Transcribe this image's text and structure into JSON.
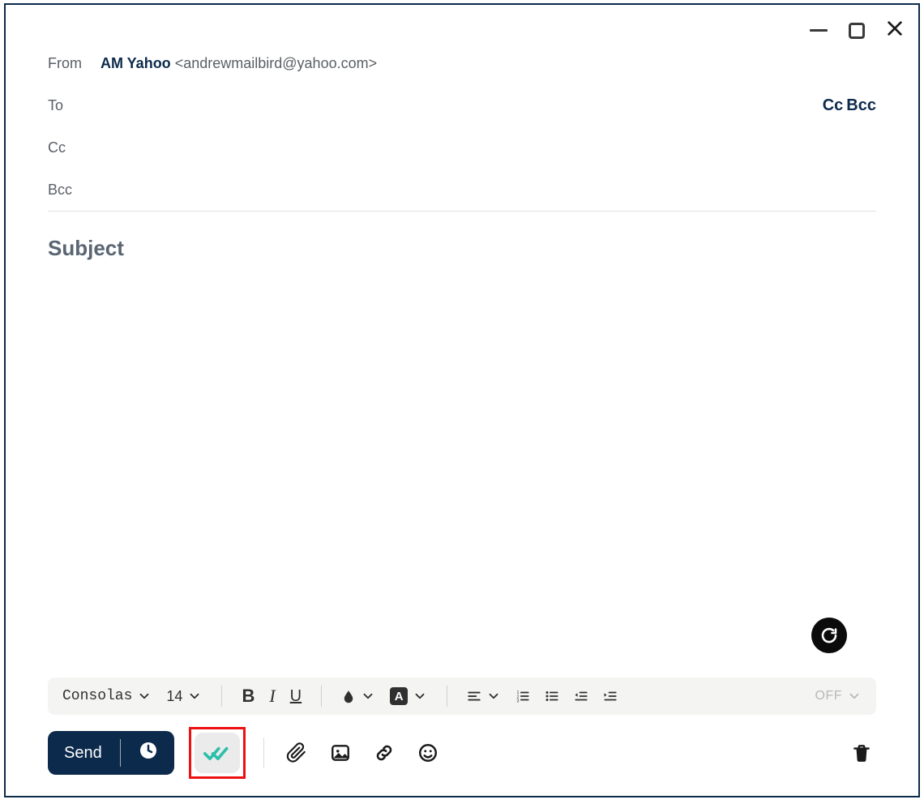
{
  "header": {
    "labels": {
      "from": "From",
      "to": "To",
      "cc": "Cc",
      "bcc": "Bcc"
    },
    "ccbcc": {
      "cc": "Cc",
      "bcc": "Bcc"
    },
    "from_name": "AM Yahoo",
    "from_email": "<andrewmailbird@yahoo.com>",
    "to_value": "",
    "cc_value": "",
    "bcc_value": ""
  },
  "subject": {
    "placeholder": "Subject",
    "value": ""
  },
  "body": "",
  "format": {
    "font": "Consolas",
    "size": "14",
    "off_label": "OFF"
  },
  "actions": {
    "send": "Send"
  }
}
